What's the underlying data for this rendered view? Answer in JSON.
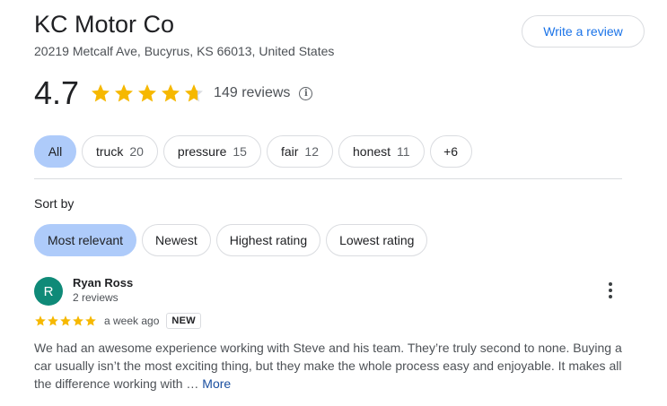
{
  "business": {
    "name": "KC Motor Co",
    "address": "20219 Metcalf Ave, Bucyrus, KS 66013, United States",
    "write_review_label": "Write a review",
    "rating": "4.7",
    "rating_value": 4.7,
    "reviews_label": "149 reviews"
  },
  "topics": {
    "items": [
      {
        "label": "All",
        "count": ""
      },
      {
        "label": "truck",
        "count": "20"
      },
      {
        "label": "pressure",
        "count": "15"
      },
      {
        "label": "fair",
        "count": "12"
      },
      {
        "label": "honest",
        "count": "11"
      }
    ],
    "more_label": "+6"
  },
  "sort": {
    "label": "Sort by",
    "options": [
      "Most relevant",
      "Newest",
      "Highest rating",
      "Lowest rating"
    ],
    "selected": "Most relevant"
  },
  "review": {
    "avatar_letter": "R",
    "avatar_color": "#0f8a78",
    "name": "Ryan Ross",
    "meta": "2 reviews",
    "stars": 5,
    "time": "a week ago",
    "badge": "NEW",
    "text": "We had an awesome experience working with Steve and his team. They’re truly second to none. Buying a car usually isn’t the most exciting thing, but they make the whole process easy and enjoyable. It makes all the difference working with … ",
    "more_label": "More"
  },
  "colors": {
    "star": "#f6b800",
    "star_empty": "#dadce0",
    "accent": "#1a73e8",
    "chip_selected": "#aecbfa"
  }
}
